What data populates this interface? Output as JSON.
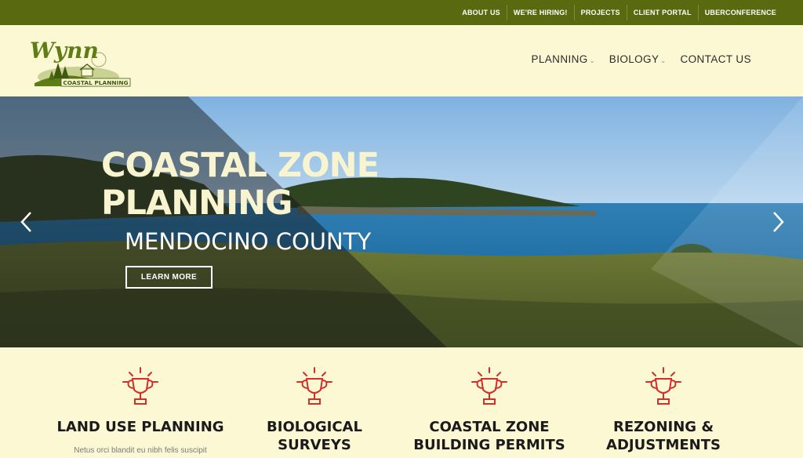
{
  "topbar": {
    "links": [
      "ABOUT US",
      "WE'RE HIRING!",
      "PROJECTS",
      "CLIENT PORTAL",
      "UBERCONFERENCE"
    ]
  },
  "logo": {
    "script_text": "Wynn",
    "banner_text": "COASTAL PLANNING"
  },
  "nav": {
    "items": [
      {
        "label": "PLANNING",
        "has_dropdown": true
      },
      {
        "label": "BIOLOGY",
        "has_dropdown": true
      },
      {
        "label": "CONTACT US",
        "has_dropdown": false
      }
    ]
  },
  "hero": {
    "title_line1": "COASTAL ZONE",
    "title_line2": "PLANNING",
    "subtitle": "MENDOCINO COUNTY",
    "button_label": "LEARN MORE"
  },
  "services": [
    {
      "title_line1": "LAND USE PLANNING",
      "title_line2": "",
      "text": "Netus orci blandit eu nibh felis suscipit"
    },
    {
      "title_line1": "BIOLOGICAL",
      "title_line2": "SURVEYS",
      "text": ""
    },
    {
      "title_line1": "COASTAL ZONE",
      "title_line2": "BUILDING PERMITS",
      "text": ""
    },
    {
      "title_line1": "REZONING &",
      "title_line2": "ADJUSTMENTS",
      "text": ""
    }
  ],
  "colors": {
    "topbar": "#58690f",
    "background": "#fdf8d4",
    "accent_red": "#d0302a",
    "logo_green": "#5f7d16"
  }
}
